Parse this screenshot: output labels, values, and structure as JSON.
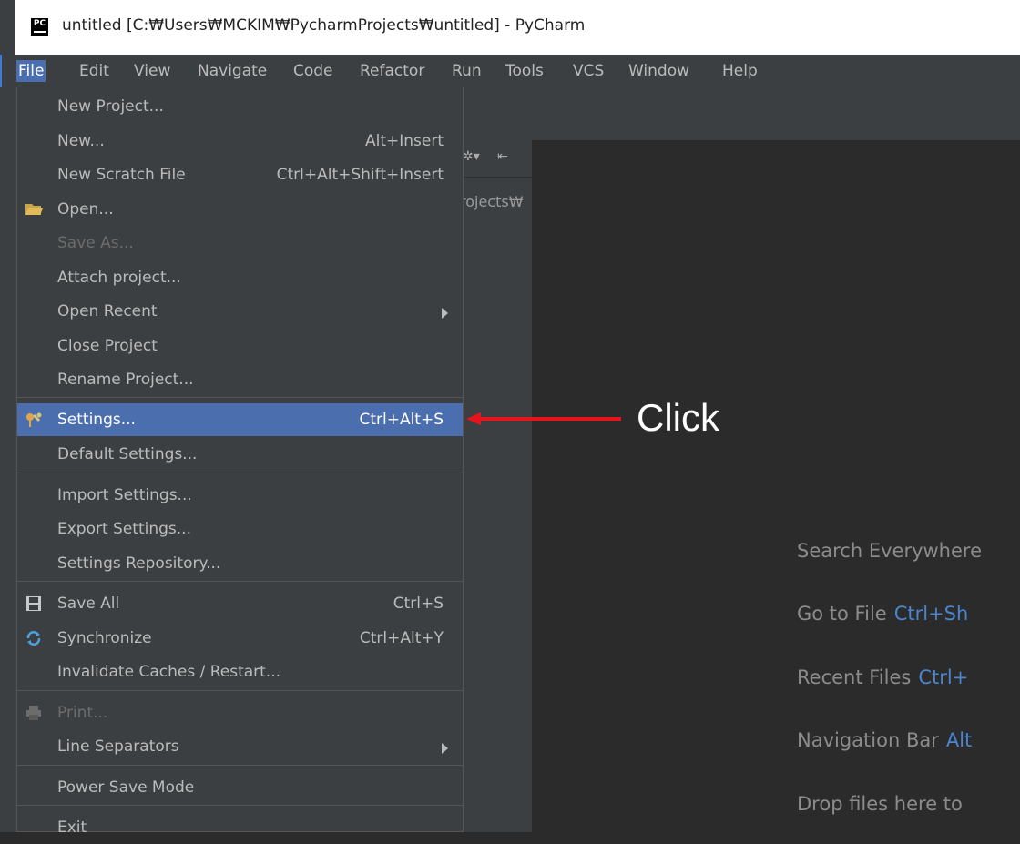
{
  "window": {
    "app_icon_text": "PC",
    "title": "untitled [C:₩Users₩MCKIM₩PycharmProjects₩untitled] - PyCharm"
  },
  "menubar": [
    "File",
    "Edit",
    "View",
    "Navigate",
    "Code",
    "Refactor",
    "Run",
    "Tools",
    "VCS",
    "Window",
    "Help"
  ],
  "project_panel": {
    "path_fragment": "rojects₩"
  },
  "file_menu": {
    "items": [
      {
        "label": "New Project...",
        "shortcut": ""
      },
      {
        "label": "New...",
        "shortcut": "Alt+Insert"
      },
      {
        "label": "New Scratch File",
        "shortcut": "Ctrl+Alt+Shift+Insert"
      },
      {
        "label": "Open...",
        "shortcut": "",
        "icon": "folder-icon"
      },
      {
        "label": "Save As...",
        "shortcut": "",
        "disabled": true
      },
      {
        "label": "Attach project...",
        "shortcut": ""
      },
      {
        "label": "Open Recent",
        "shortcut": "",
        "submenu": true
      },
      {
        "label": "Close Project",
        "shortcut": ""
      },
      {
        "label": "Rename Project...",
        "shortcut": ""
      },
      {
        "label": "Settings...",
        "shortcut": "Ctrl+Alt+S",
        "icon": "settings-wrench-icon",
        "selected": true
      },
      {
        "label": "Default Settings...",
        "shortcut": ""
      },
      {
        "label": "Import Settings...",
        "shortcut": ""
      },
      {
        "label": "Export Settings...",
        "shortcut": ""
      },
      {
        "label": "Settings Repository...",
        "shortcut": ""
      },
      {
        "label": "Save All",
        "shortcut": "Ctrl+S",
        "icon": "save-icon"
      },
      {
        "label": "Synchronize",
        "shortcut": "Ctrl+Alt+Y",
        "icon": "sync-icon"
      },
      {
        "label": "Invalidate Caches / Restart...",
        "shortcut": ""
      },
      {
        "label": "Print...",
        "shortcut": "",
        "disabled": true,
        "icon": "print-icon"
      },
      {
        "label": "Line Separators",
        "shortcut": "",
        "submenu": true
      },
      {
        "label": "Power Save Mode",
        "shortcut": ""
      },
      {
        "label": "Exit",
        "shortcut": ""
      }
    ]
  },
  "annotation": {
    "label": "Click",
    "color": "#e8141b"
  },
  "editor_hints": [
    {
      "text": "Search Everywhere",
      "key": ""
    },
    {
      "text": "Go to File",
      "key": "Ctrl+Sh"
    },
    {
      "text": "Recent Files",
      "key": "Ctrl+"
    },
    {
      "text": "Navigation Bar",
      "key": "Alt"
    },
    {
      "text": "Drop files here to",
      "key": ""
    }
  ],
  "colors": {
    "menu_bg": "#3c3f41",
    "editor_bg": "#2b2b2b",
    "selection": "#4b6eaf",
    "hint_key": "#4a85d0"
  }
}
